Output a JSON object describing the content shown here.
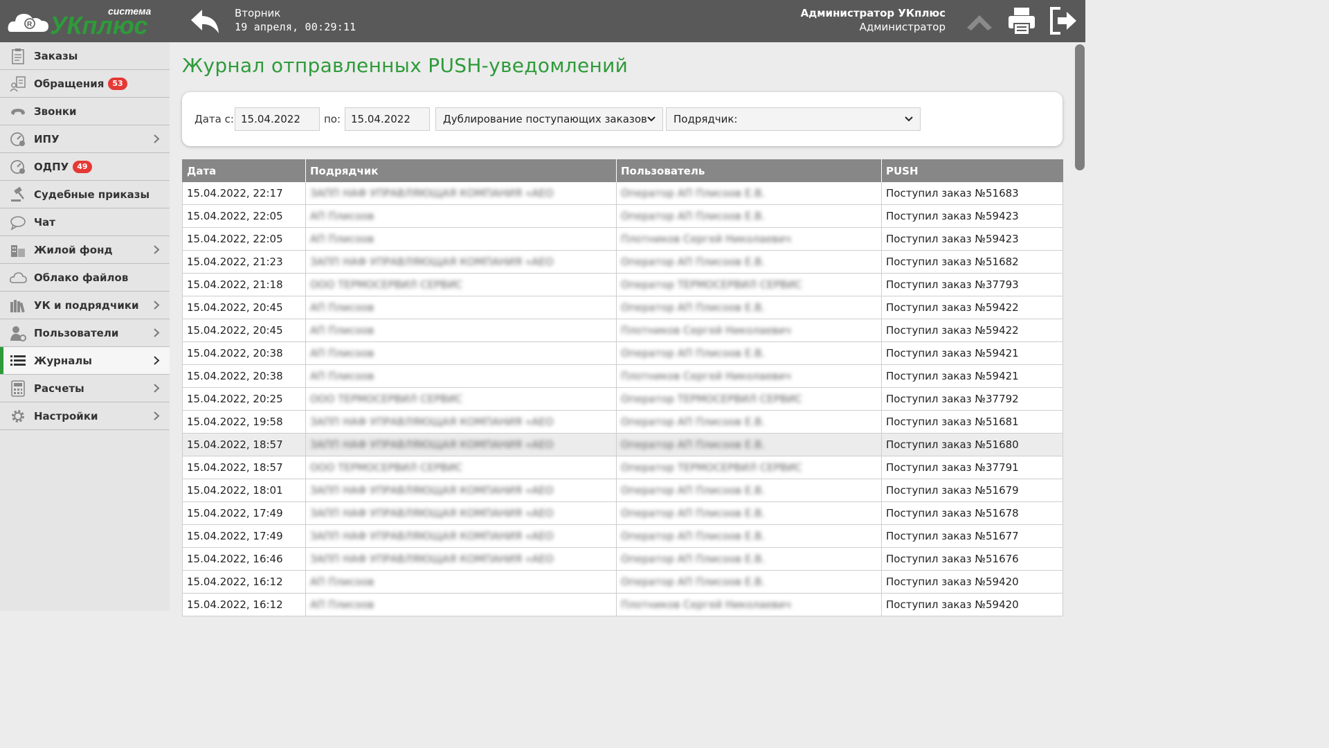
{
  "header": {
    "logo_brand": "УКплюс",
    "logo_system": "система",
    "day": "Вторник",
    "datetime": "19 апреля, 00:29:11",
    "user_name": "Администратор УКплюс",
    "user_role": "Администратор",
    "icons": [
      "back-arrow-icon",
      "scroll-up-icon",
      "printer-icon",
      "logout-icon"
    ]
  },
  "sidebar": {
    "items": [
      {
        "label": "Заказы",
        "icon": "clipboard-icon"
      },
      {
        "label": "Обращения",
        "icon": "person-document-icon",
        "badge": "53"
      },
      {
        "label": "Звонки",
        "icon": "phone-icon"
      },
      {
        "label": "ИПУ",
        "icon": "meter-icon"
      },
      {
        "label": "ОДПУ",
        "icon": "meter-icon",
        "badge": "49"
      },
      {
        "label": "Судебные приказы",
        "icon": "gavel-icon"
      },
      {
        "label": "Чат",
        "icon": "chat-bubble-icon"
      },
      {
        "label": "Жилой фонд",
        "icon": "buildings-icon"
      },
      {
        "label": "Облако файлов",
        "icon": "cloud-icon"
      },
      {
        "label": "УК и подрядчики",
        "icon": "books-icon"
      },
      {
        "label": "Пользователи",
        "icon": "user-gear-icon"
      },
      {
        "label": "Журналы",
        "icon": "list-icon",
        "active": true
      },
      {
        "label": "Расчеты",
        "icon": "calculator-icon"
      },
      {
        "label": "Настройки",
        "icon": "gear-icon"
      }
    ]
  },
  "main": {
    "title": "Журнал отправленных PUSH-уведомлений",
    "filters": {
      "date_from_label": "Дата с:",
      "date_from": "15.04.2022",
      "date_to_label": "по:",
      "date_to": "15.04.2022",
      "type_selected": "Дублирование поступающих заказов",
      "contractor_selected": "Подрядчик:"
    },
    "table": {
      "headers": [
        "Дата",
        "Подрядчик",
        "Пользователь",
        "PUSH"
      ],
      "rows": [
        {
          "date": "15.04.2022, 22:17",
          "contractor": "ЗАПП НАФ УПРАВЛЯЮЩАЯ КОМПАНИЯ «АЕО",
          "user": "Оператор АП Плисоов Е.В.",
          "push": "Поступил заказ №51683"
        },
        {
          "date": "15.04.2022, 22:05",
          "contractor": "АП Плисоов",
          "user": "Оператор АП Плисоов Е.В.",
          "push": "Поступил заказ №59423"
        },
        {
          "date": "15.04.2022, 22:05",
          "contractor": "АП Плисоов",
          "user": "Плотников Сергей Николаевич",
          "push": "Поступил заказ №59423"
        },
        {
          "date": "15.04.2022, 21:23",
          "contractor": "ЗАПП НАФ УПРАВЛЯЮЩАЯ КОМПАНИЯ «АЕО",
          "user": "Оператор АП Плисоов Е.В.",
          "push": "Поступил заказ №51682"
        },
        {
          "date": "15.04.2022, 21:18",
          "contractor": "ООО ТЕРМОСЕРВИЛ СЕРВИС",
          "user": "Оператор ТЕРМОСЕРВИЛ СЕРВИС",
          "push": "Поступил заказ №37793"
        },
        {
          "date": "15.04.2022, 20:45",
          "contractor": "АП Плисоов",
          "user": "Оператор АП Плисоов Е.В.",
          "push": "Поступил заказ №59422"
        },
        {
          "date": "15.04.2022, 20:45",
          "contractor": "АП Плисоов",
          "user": "Плотников Сергей Николаевич",
          "push": "Поступил заказ №59422"
        },
        {
          "date": "15.04.2022, 20:38",
          "contractor": "АП Плисоов",
          "user": "Оператор АП Плисоов Е.В.",
          "push": "Поступил заказ №59421"
        },
        {
          "date": "15.04.2022, 20:38",
          "contractor": "АП Плисоов",
          "user": "Плотников Сергей Николаевич",
          "push": "Поступил заказ №59421"
        },
        {
          "date": "15.04.2022, 20:25",
          "contractor": "ООО ТЕРМОСЕРВИЛ СЕРВИС",
          "user": "Оператор ТЕРМОСЕРВИЛ СЕРВИС",
          "push": "Поступил заказ №37792"
        },
        {
          "date": "15.04.2022, 19:58",
          "contractor": "ЗАПП НАФ УПРАВЛЯЮЩАЯ КОМПАНИЯ «АЕО",
          "user": "Оператор АП Плисоов Е.В.",
          "push": "Поступил заказ №51681"
        },
        {
          "date": "15.04.2022, 18:57",
          "contractor": "ЗАПП НАФ УПРАВЛЯЮЩАЯ КОМПАНИЯ «АЕО",
          "user": "Оператор АП Плисоов Е.В.",
          "push": "Поступил заказ №51680",
          "highlight": true
        },
        {
          "date": "15.04.2022, 18:57",
          "contractor": "ООО ТЕРМОСЕРВИЛ СЕРВИС",
          "user": "Оператор ТЕРМОСЕРВИЛ СЕРВИС",
          "push": "Поступил заказ №37791"
        },
        {
          "date": "15.04.2022, 18:01",
          "contractor": "ЗАПП НАФ УПРАВЛЯЮЩАЯ КОМПАНИЯ «АЕО",
          "user": "Оператор АП Плисоов Е.В.",
          "push": "Поступил заказ №51679"
        },
        {
          "date": "15.04.2022, 17:49",
          "contractor": "ЗАПП НАФ УПРАВЛЯЮЩАЯ КОМПАНИЯ «АЕО",
          "user": "Оператор АП Плисоов Е.В.",
          "push": "Поступил заказ №51678"
        },
        {
          "date": "15.04.2022, 17:49",
          "contractor": "ЗАПП НАФ УПРАВЛЯЮЩАЯ КОМПАНИЯ «АЕО",
          "user": "Оператор АП Плисоов Е.В.",
          "push": "Поступил заказ №51677"
        },
        {
          "date": "15.04.2022, 16:46",
          "contractor": "ЗАПП НАФ УПРАВЛЯЮЩАЯ КОМПАНИЯ «АЕО",
          "user": "Оператор АП Плисоов Е.В.",
          "push": "Поступил заказ №51676"
        },
        {
          "date": "15.04.2022, 16:12",
          "contractor": "АП Плисоов",
          "user": "Оператор АП Плисоов Е.В.",
          "push": "Поступил заказ №59420"
        },
        {
          "date": "15.04.2022, 16:12",
          "contractor": "АП Плисоов",
          "user": "Плотников Сергей Николаевич",
          "push": "Поступил заказ №59420"
        }
      ]
    }
  },
  "colors": {
    "accent_green": "#2e9b3a",
    "header_bg": "#595959",
    "table_header_bg": "#878787",
    "badge_red": "#e53935"
  }
}
